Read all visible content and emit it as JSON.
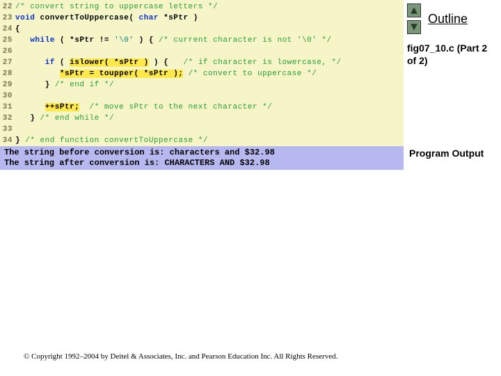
{
  "lines": [
    {
      "n": 22,
      "tokens": [
        [
          "cmt",
          "/* convert string to uppercase letters */"
        ]
      ]
    },
    {
      "n": 23,
      "tokens": [
        [
          "kw",
          "void"
        ],
        [
          "pn",
          " "
        ],
        [
          "fn",
          "convertToUppercase("
        ],
        [
          "pn",
          " "
        ],
        [
          "kw",
          "char"
        ],
        [
          "pn",
          " "
        ],
        [
          "fn",
          "*sPtr"
        ],
        [
          "pn",
          " "
        ],
        [
          "fn",
          ")"
        ]
      ]
    },
    {
      "n": 24,
      "tokens": [
        [
          "pn",
          "{"
        ]
      ]
    },
    {
      "n": 25,
      "tokens": [
        [
          "pn",
          "   "
        ],
        [
          "kw",
          "while"
        ],
        [
          "pn",
          " "
        ],
        [
          "fn",
          "("
        ],
        [
          "pn",
          " "
        ],
        [
          "fn",
          "*sPtr"
        ],
        [
          "pn",
          " "
        ],
        [
          "fn",
          "!="
        ],
        [
          "pn",
          " "
        ],
        [
          "str",
          "'\\0'"
        ],
        [
          "pn",
          " "
        ],
        [
          "fn",
          ")"
        ],
        [
          "pn",
          " "
        ],
        [
          "pn",
          "{"
        ],
        [
          "pn",
          " "
        ],
        [
          "cmt",
          "/* current character is not '\\0' */"
        ]
      ]
    },
    {
      "n": 26,
      "tokens": [
        [
          "pn",
          " "
        ]
      ]
    },
    {
      "n": 27,
      "tokens": [
        [
          "pn",
          "      "
        ],
        [
          "kw",
          "if"
        ],
        [
          "pn",
          " "
        ],
        [
          "fn",
          "("
        ],
        [
          "pn",
          " "
        ],
        [
          "hl",
          "islower( *sPtr )"
        ],
        [
          "pn",
          " "
        ],
        [
          "fn",
          ")"
        ],
        [
          "pn",
          " "
        ],
        [
          "pn",
          "{"
        ],
        [
          "pn",
          "   "
        ],
        [
          "cmt",
          "/* if character is lowercase, */"
        ]
      ]
    },
    {
      "n": 28,
      "tokens": [
        [
          "pn",
          "         "
        ],
        [
          "hl",
          "*sPtr = toupper( *sPtr );"
        ],
        [
          "pn",
          " "
        ],
        [
          "cmt",
          "/* convert to uppercase */"
        ]
      ]
    },
    {
      "n": 29,
      "tokens": [
        [
          "pn",
          "      "
        ],
        [
          "pn",
          "}"
        ],
        [
          "pn",
          " "
        ],
        [
          "cmt",
          "/* end if */"
        ]
      ]
    },
    {
      "n": 30,
      "tokens": [
        [
          "pn",
          " "
        ]
      ]
    },
    {
      "n": 31,
      "tokens": [
        [
          "pn",
          "      "
        ],
        [
          "hl",
          "++sPtr;"
        ],
        [
          "pn",
          "  "
        ],
        [
          "cmt",
          "/* move sPtr to the next character */"
        ]
      ]
    },
    {
      "n": 32,
      "tokens": [
        [
          "pn",
          "   "
        ],
        [
          "pn",
          "}"
        ],
        [
          "pn",
          " "
        ],
        [
          "cmt",
          "/* end while */"
        ]
      ]
    },
    {
      "n": 33,
      "tokens": [
        [
          "pn",
          " "
        ]
      ]
    },
    {
      "n": 34,
      "tokens": [
        [
          "pn",
          "}"
        ],
        [
          "pn",
          " "
        ],
        [
          "cmt",
          "/* end function convertToUppercase */"
        ]
      ]
    }
  ],
  "output": {
    "line1": "The string before conversion is: characters and $32.98",
    "line2": "The string after conversion is: CHARACTERS AND $32.98"
  },
  "right": {
    "outline": "Outline",
    "figref": "fig07_10.c (Part 2 of 2)",
    "program_output": "Program Output"
  },
  "copyright": "© Copyright 1992–2004 by Deitel & Associates, Inc. and Pearson Education Inc. All Rights Reserved."
}
